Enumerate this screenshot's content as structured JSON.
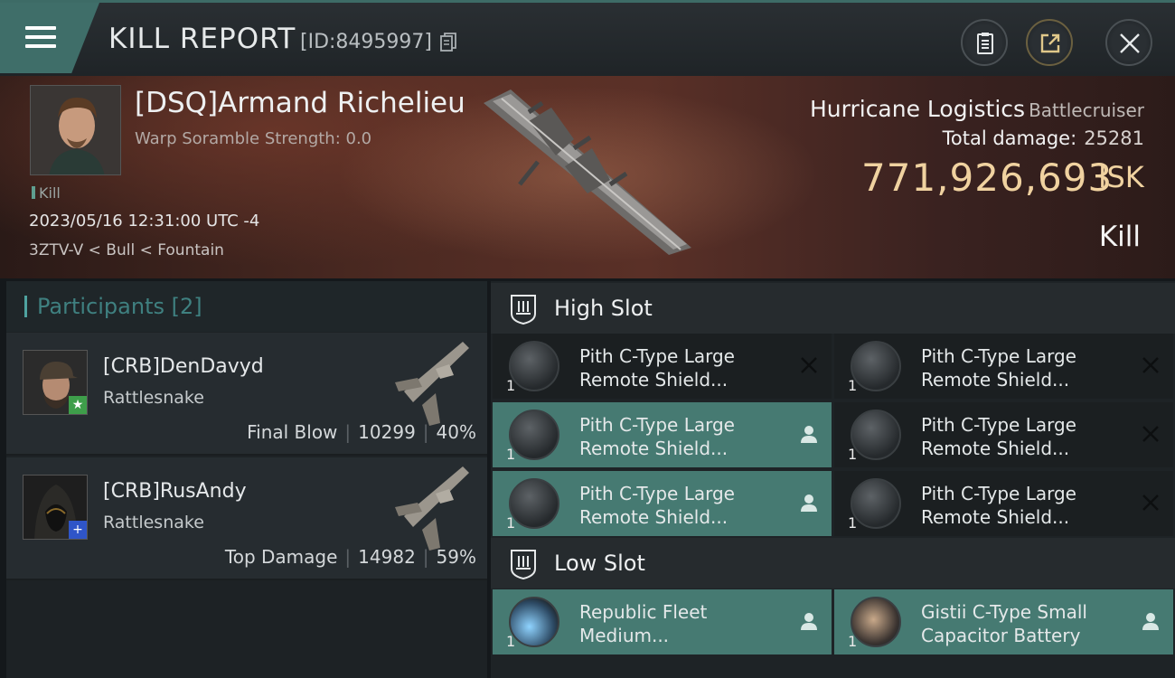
{
  "header": {
    "title": "KILL REPORT",
    "id_text": "[ID:8495997]",
    "buttons": [
      "clipboard-icon",
      "share-icon",
      "close-icon"
    ]
  },
  "victim": {
    "name": "[DSQ]Armand Richelieu",
    "warp_scramble": "Warp Soramble Strength: 0.0",
    "tag": "Kill",
    "datetime": "2023/05/16 12:31:00 UTC -4",
    "location": "3ZTV-V < Bull < Fountain"
  },
  "ship": {
    "name": "Hurricane Logistics",
    "class": "Battlecruiser",
    "total_damage_label": "Total damage:",
    "total_damage_value": "25281",
    "isk_value": "771,926,693",
    "isk_unit": "ISK",
    "result": "Kill"
  },
  "participants": {
    "title": "Participants",
    "count": "[2]",
    "rows": [
      {
        "name": "[CRB]DenDavyd",
        "ship": "Rattlesnake",
        "label": "Final Blow",
        "damage": "10299",
        "percent": "40%",
        "badge": "star-icon",
        "badge_color": "#3e9e4a"
      },
      {
        "name": "[CRB]RusAndy",
        "ship": "Rattlesnake",
        "label": "Top Damage",
        "damage": "14982",
        "percent": "59%",
        "badge": "plus-icon",
        "badge_color": "#2f55c8"
      }
    ]
  },
  "slots": {
    "high": {
      "label": "High Slot",
      "modules": [
        {
          "name_line1": "Pith C-Type Large",
          "name_line2": "Remote Shield...",
          "qty": "1",
          "status": "destroyed"
        },
        {
          "name_line1": "Pith C-Type Large",
          "name_line2": "Remote Shield...",
          "qty": "1",
          "status": "destroyed"
        },
        {
          "name_line1": "Pith C-Type Large",
          "name_line2": "Remote Shield...",
          "qty": "1",
          "status": "dropped"
        },
        {
          "name_line1": "Pith C-Type Large",
          "name_line2": "Remote Shield...",
          "qty": "1",
          "status": "destroyed"
        },
        {
          "name_line1": "Pith C-Type Large",
          "name_line2": "Remote Shield...",
          "qty": "1",
          "status": "dropped"
        },
        {
          "name_line1": "Pith C-Type Large",
          "name_line2": "Remote Shield...",
          "qty": "1",
          "status": "destroyed"
        }
      ]
    },
    "low": {
      "label": "Low Slot",
      "modules": [
        {
          "name_line1": "Republic Fleet",
          "name_line2": "Medium...",
          "qty": "1",
          "status": "dropped"
        },
        {
          "name_line1": "Gistii C-Type Small",
          "name_line2": "Capacitor Battery",
          "qty": "1",
          "status": "dropped"
        }
      ]
    }
  },
  "colors": {
    "accent": "#3f6e69",
    "isk": "#f0d2a0",
    "dropped_bg": "#467a72"
  }
}
